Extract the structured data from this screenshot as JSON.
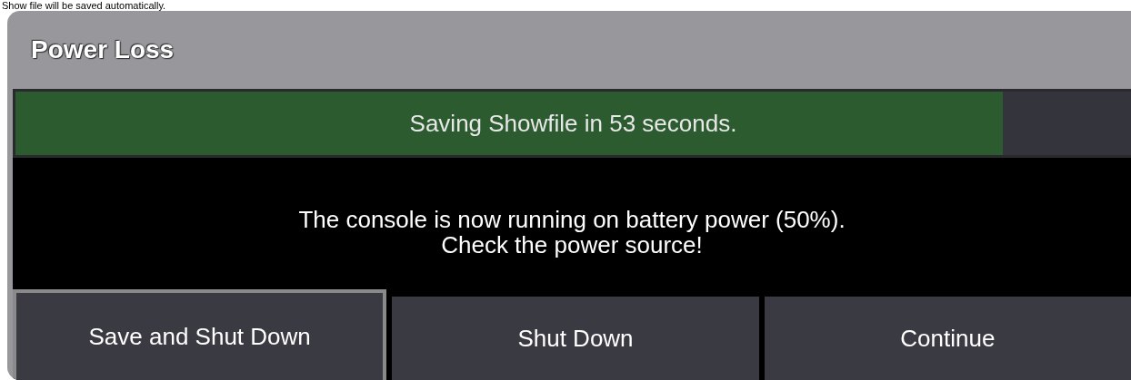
{
  "caption": "Show file will be saved automatically.",
  "window": {
    "title": "Power Loss"
  },
  "progress": {
    "label": "Saving Showfile in 53 seconds.",
    "level": 0.885
  },
  "message": [
    "The console is now running on battery power (50%).",
    "Check the power source!"
  ],
  "buttons": [
    {
      "label": "Save and Shut Down",
      "selected": true
    },
    {
      "label": "Shut Down",
      "selected": false
    },
    {
      "label": "Continue",
      "selected": false
    }
  ]
}
